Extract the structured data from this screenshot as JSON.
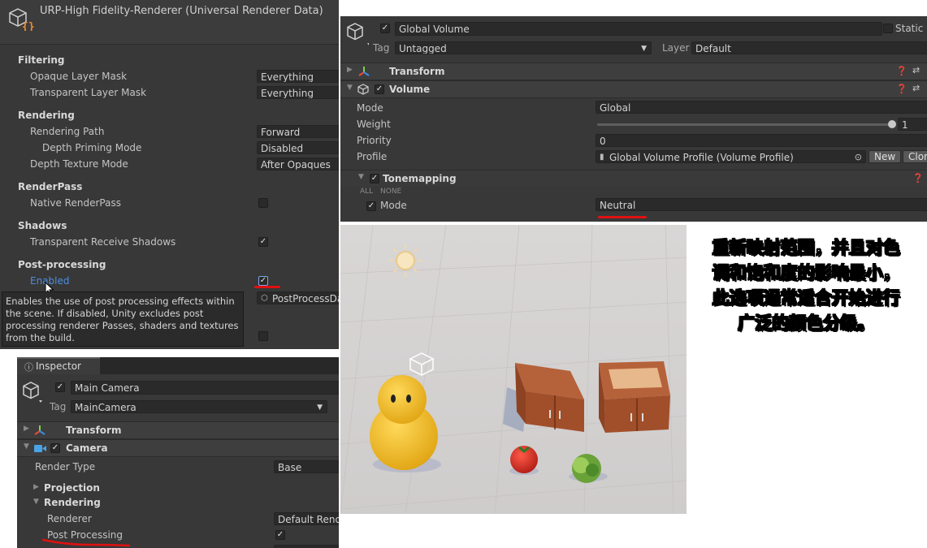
{
  "renderer_panel": {
    "title": "URP-High Fidelity-Renderer (Universal Renderer Data)",
    "filtering": {
      "header": "Filtering",
      "opaque_label": "Opaque Layer Mask",
      "opaque_value": "Everything",
      "transparent_label": "Transparent Layer Mask",
      "transparent_value": "Everything"
    },
    "rendering": {
      "header": "Rendering",
      "path_label": "Rendering Path",
      "path_value": "Forward",
      "depth_priming_label": "Depth Priming Mode",
      "depth_priming_value": "Disabled",
      "depth_texture_label": "Depth Texture Mode",
      "depth_texture_value": "After Opaques"
    },
    "renderpass": {
      "header": "RenderPass",
      "native_label": "Native RenderPass",
      "native_checked": false
    },
    "shadows": {
      "header": "Shadows",
      "transparent_receive_label": "Transparent Receive Shadows",
      "transparent_receive_checked": true
    },
    "postprocessing": {
      "header": "Post-processing",
      "enabled_label": "Enabled",
      "enabled_checked": true,
      "data_value": "PostProcessDa",
      "tooltip": "Enables the use of post processing effects within the scene. If disabled, Unity excludes post processing renderer Passes, shaders and textures from the build."
    }
  },
  "volume_panel": {
    "object_name": "Global Volume",
    "static_label": "Static",
    "tag_label": "Tag",
    "tag_value": "Untagged",
    "layer_label": "Layer",
    "layer_value": "Default",
    "transform_label": "Transform",
    "volume_label": "Volume",
    "mode_label": "Mode",
    "mode_value": "Global",
    "weight_label": "Weight",
    "weight_value": "1",
    "priority_label": "Priority",
    "priority_value": "0",
    "profile_label": "Profile",
    "profile_value": "Global Volume Profile (Volume Profile)",
    "new_button": "New",
    "clone_button": "Clon",
    "tonemapping_label": "Tonemapping",
    "all_label": "ALL",
    "none_label": "NONE",
    "tm_mode_label": "Mode",
    "tm_mode_value": "Neutral"
  },
  "inspector_panel": {
    "tab_label": "Inspector",
    "object_name": "Main Camera",
    "tag_label": "Tag",
    "tag_value": "MainCamera",
    "transform_label": "Transform",
    "camera_label": "Camera",
    "render_type_label": "Render Type",
    "render_type_value": "Base",
    "projection_label": "Projection",
    "rendering_label": "Rendering",
    "renderer_label": "Renderer",
    "renderer_value": "Default Rende",
    "post_processing_label": "Post Processing",
    "post_processing_checked": true
  },
  "annotation": {
    "lines": [
      "重新映射范围，并且对色",
      "调和饱和度的影响最小，",
      "此选项通常适合开始进行",
      "广泛的颜色分级。"
    ]
  },
  "colors": {
    "accent_red": "#e01010",
    "panel_bg": "#383838",
    "field_bg": "#2a2a2a",
    "link_blue": "#4c8de0"
  }
}
